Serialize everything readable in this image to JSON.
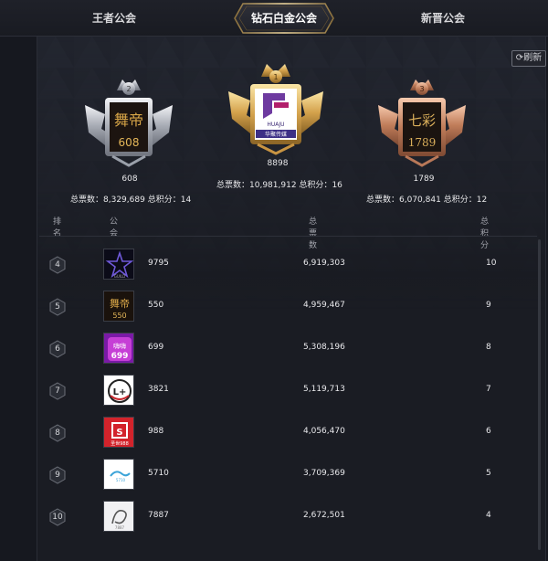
{
  "tabs": [
    {
      "label": "王者公会",
      "active": false
    },
    {
      "label": "钻石白金公会",
      "active": true
    },
    {
      "label": "新晋公会",
      "active": false
    }
  ],
  "refresh_label": "刷新",
  "podium": [
    {
      "rank": "2",
      "logo_text": "608",
      "name": "608",
      "votes_label": "总票数：",
      "votes": "8,329,689",
      "score_label": "总积分：",
      "score": "14",
      "medal": "silver"
    },
    {
      "rank": "1",
      "logo_text": "HUAJU",
      "name": "8898",
      "votes_label": "总票数：",
      "votes": "10,981,912",
      "score_label": "总积分：",
      "score": "16",
      "medal": "gold"
    },
    {
      "rank": "3",
      "logo_text": "1789",
      "name": "1789",
      "votes_label": "总票数：",
      "votes": "6,070,841",
      "score_label": "总积分：",
      "score": "12",
      "medal": "bronze"
    }
  ],
  "table_headers": {
    "rank": "排名",
    "guild": "公会",
    "votes": "总票数",
    "score": "总积分"
  },
  "rows": [
    {
      "rank": "4",
      "id": "9795",
      "votes": "6,919,303",
      "score": "10",
      "logo": "star"
    },
    {
      "rank": "5",
      "id": "550",
      "votes": "4,959,467",
      "score": "9",
      "logo": "550"
    },
    {
      "rank": "6",
      "id": "699",
      "votes": "5,308,196",
      "score": "8",
      "logo": "699"
    },
    {
      "rank": "7",
      "id": "3821",
      "votes": "5,119,713",
      "score": "7",
      "logo": "L+"
    },
    {
      "rank": "8",
      "id": "988",
      "votes": "4,056,470",
      "score": "6",
      "logo": "988"
    },
    {
      "rank": "9",
      "id": "5710",
      "votes": "3,709,369",
      "score": "5",
      "logo": "5710"
    },
    {
      "rank": "10",
      "id": "7887",
      "votes": "2,672,501",
      "score": "4",
      "logo": "7887"
    }
  ],
  "colors": {
    "gold": "#d9b46a",
    "silver": "#c8ccd4",
    "bronze": "#d59a7a",
    "background": "#16181f"
  }
}
